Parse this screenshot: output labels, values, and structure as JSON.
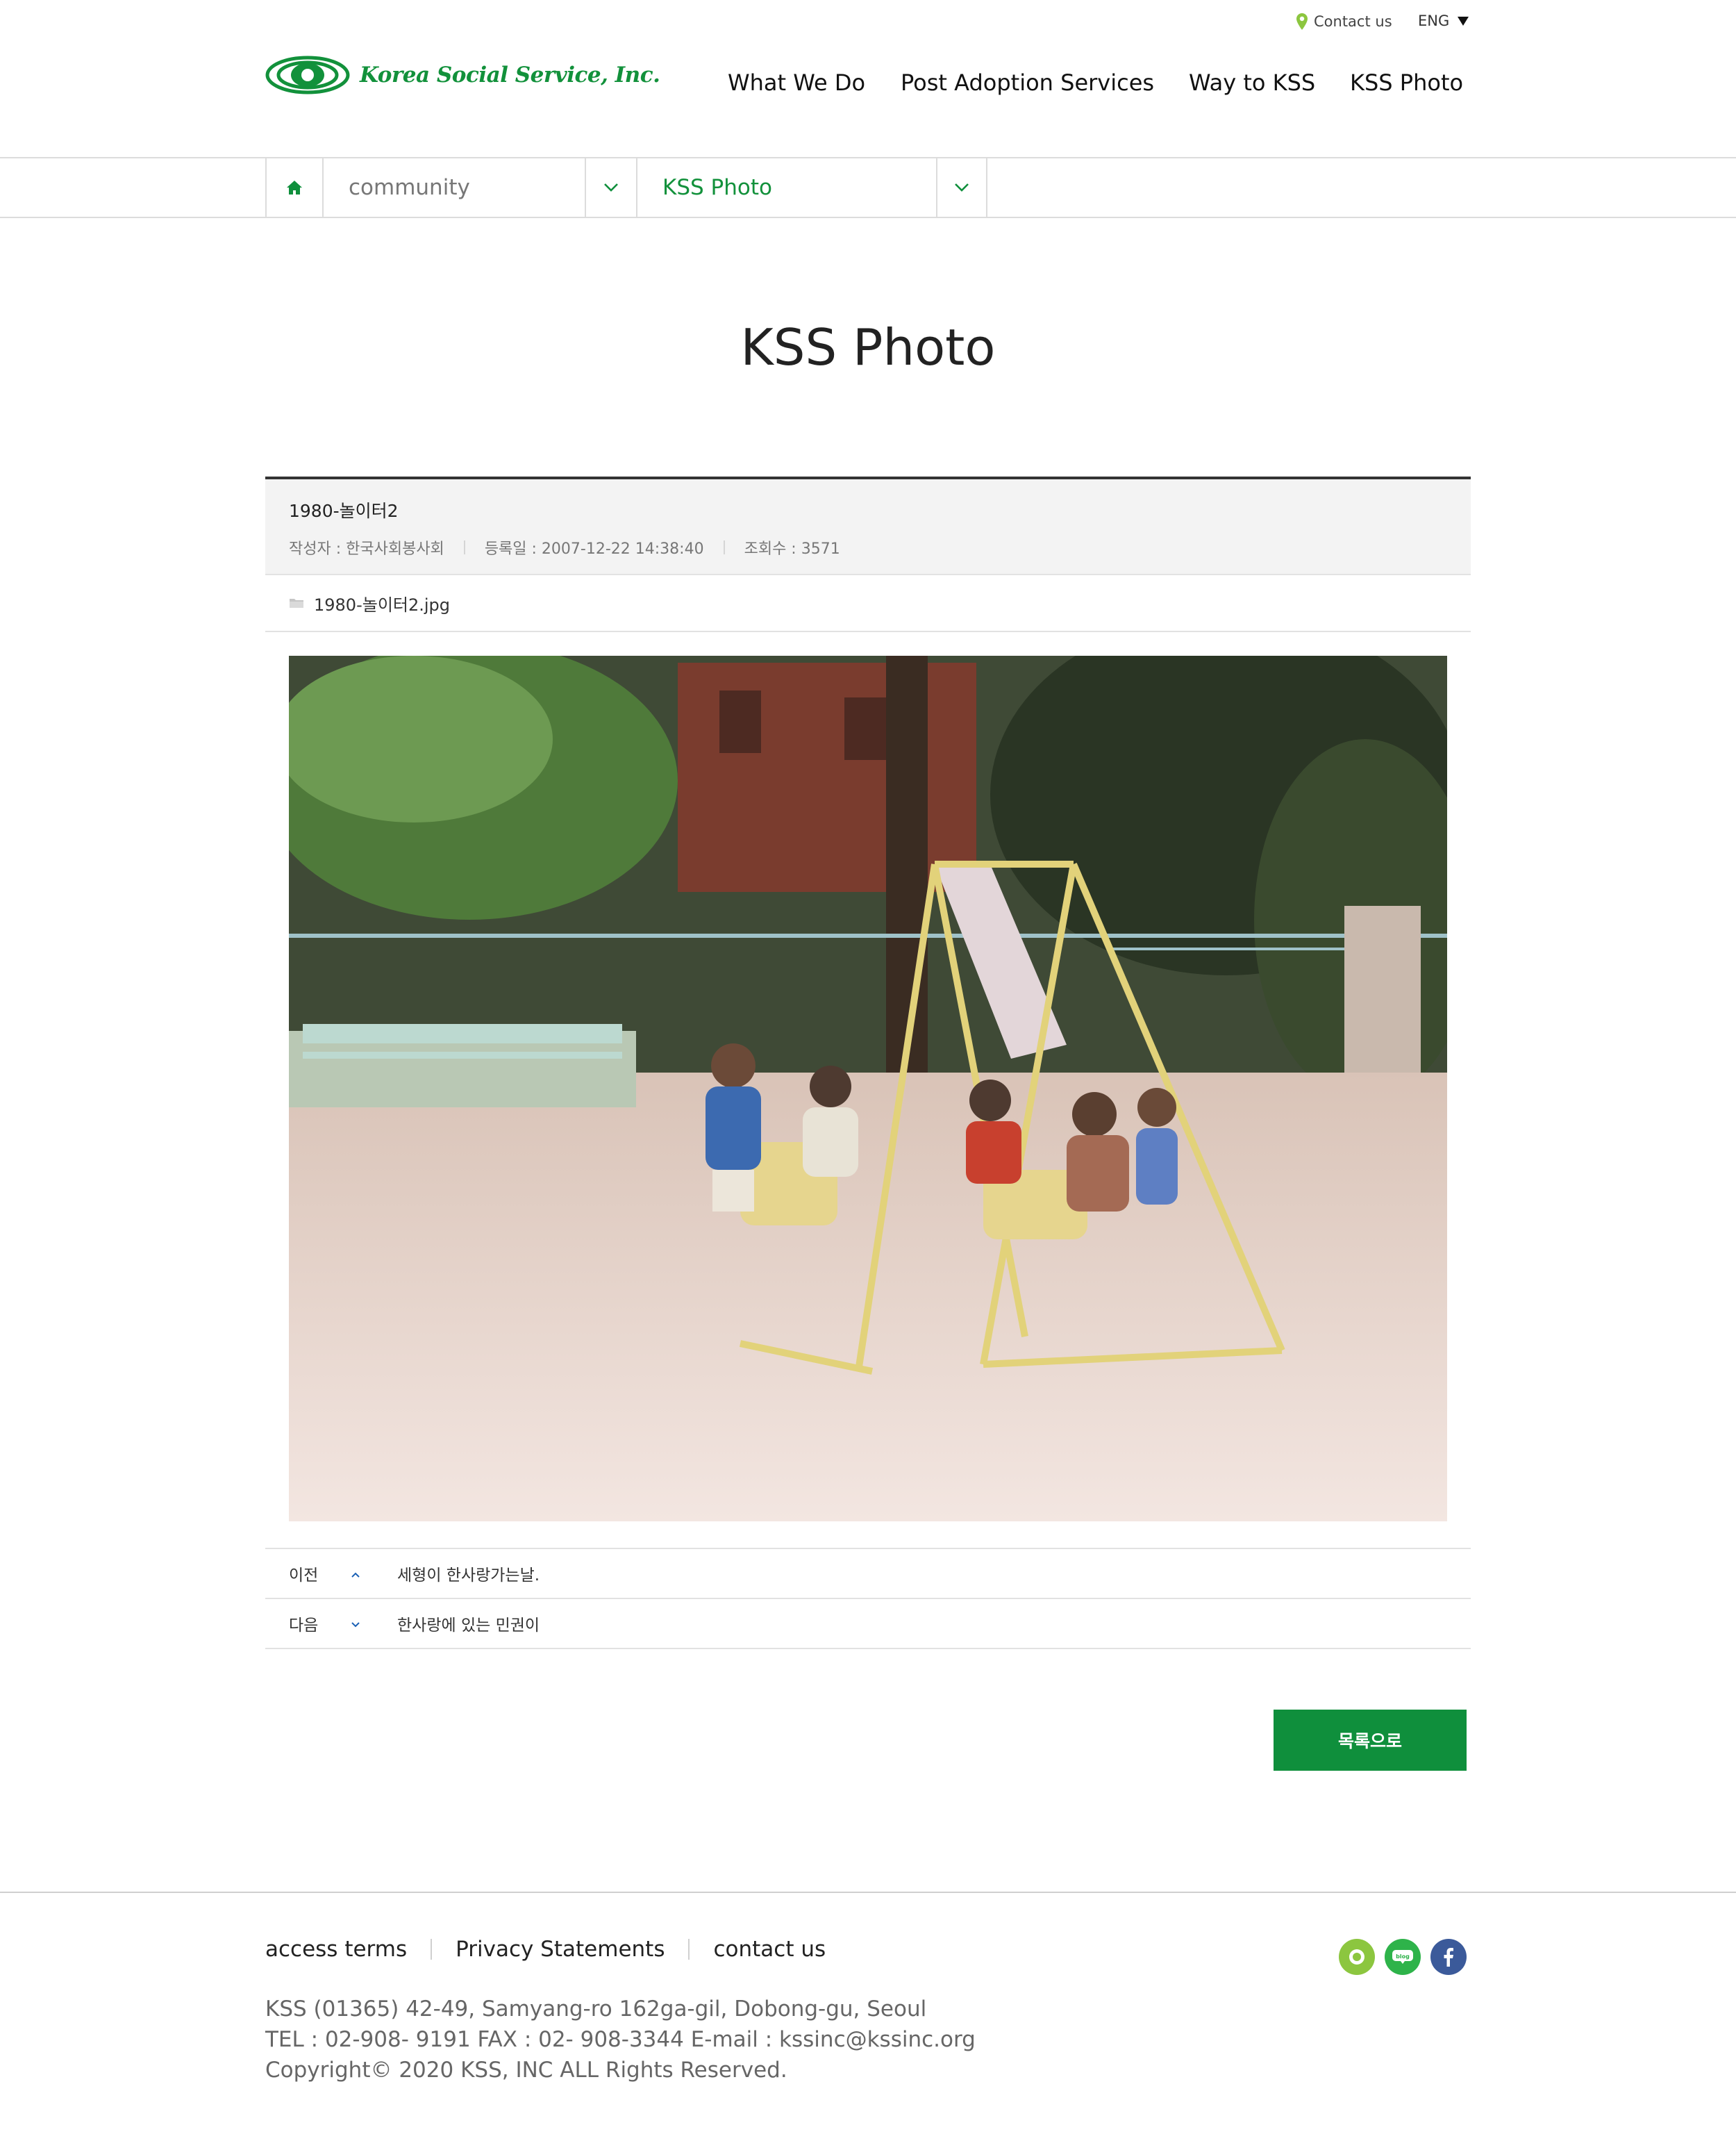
{
  "header": {
    "logo_text": "Korea Social Service, Inc.",
    "contact_label": "Contact us",
    "lang_label": "ENG",
    "nav": [
      "What We Do",
      "Post Adoption Services",
      "Way to KSS",
      "KSS Photo"
    ]
  },
  "location": {
    "home_icon": "home-icon",
    "level1": "community",
    "level2": "KSS Photo"
  },
  "page_title": "KSS Photo",
  "post": {
    "subject": "1980-놀이터2",
    "author": "작성자 : 한국사회봉사회",
    "date": "등록일 : 2007-12-22 14:38:40",
    "views": "조회수 : 3571",
    "attachment": "1980-놀이터2.jpg"
  },
  "post_nav": {
    "prev_label": "이전",
    "prev_title": "세형이 한사랑가는날.",
    "next_label": "다음",
    "next_title": "한사랑에 있는 민권이"
  },
  "list_button": "목록으로",
  "footer": {
    "links": [
      "access terms",
      "Privacy Statements",
      "contact us"
    ],
    "address": "KSS (01365) 42-49, Samyang-ro 162ga-gil, Dobong-gu, Seoul",
    "tel": "TEL : 02-908- 9191 FAX : 02- 908-3344 E-mail : kssinc@kssinc.org",
    "copyright": "Copyright© 2020 KSS, INC ALL Rights Reserved.",
    "sns_icons": [
      "sns-green-icon",
      "blog-icon",
      "facebook-icon"
    ]
  },
  "colors": {
    "brand_green": "#12913b",
    "button_green": "#0f8f3c"
  }
}
